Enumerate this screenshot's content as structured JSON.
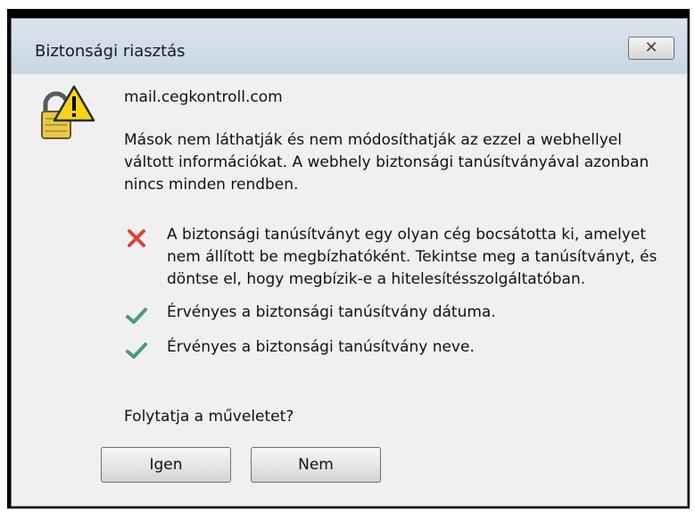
{
  "window": {
    "title": "Biztonsági riasztás",
    "close_icon": "close-icon",
    "close_glyph": "✕"
  },
  "alert": {
    "icon": "lock-warning-icon",
    "host": "mail.cegkontroll.com",
    "message": "Mások nem láthatják és nem módosíthatják az ezzel a webhellyel váltott információkat. A webhely biztonsági tanúsítványával azonban nincs minden rendben.",
    "items": [
      {
        "status": "error",
        "icon": "red-x-icon",
        "text": "A biztonsági tanúsítványt egy olyan cég bocsátotta ki, amelyet nem állított be megbízhatóként. Tekintse meg a tanúsítványt, és döntse el, hogy megbízik-e a hitelesítésszolgáltatóban."
      },
      {
        "status": "ok",
        "icon": "green-check-icon",
        "text": "Érvényes a biztonsági tanúsítvány dátuma."
      },
      {
        "status": "ok",
        "icon": "green-check-icon",
        "text": "Érvényes a biztonsági tanúsítvány neve."
      }
    ],
    "question": "Folytatja a műveletet?"
  },
  "buttons": {
    "yes_label": "Igen",
    "no_label": "Nem"
  },
  "colors": {
    "error": "#d9433a",
    "ok": "#4a9a7e",
    "title_bar": "#d3dde9"
  }
}
